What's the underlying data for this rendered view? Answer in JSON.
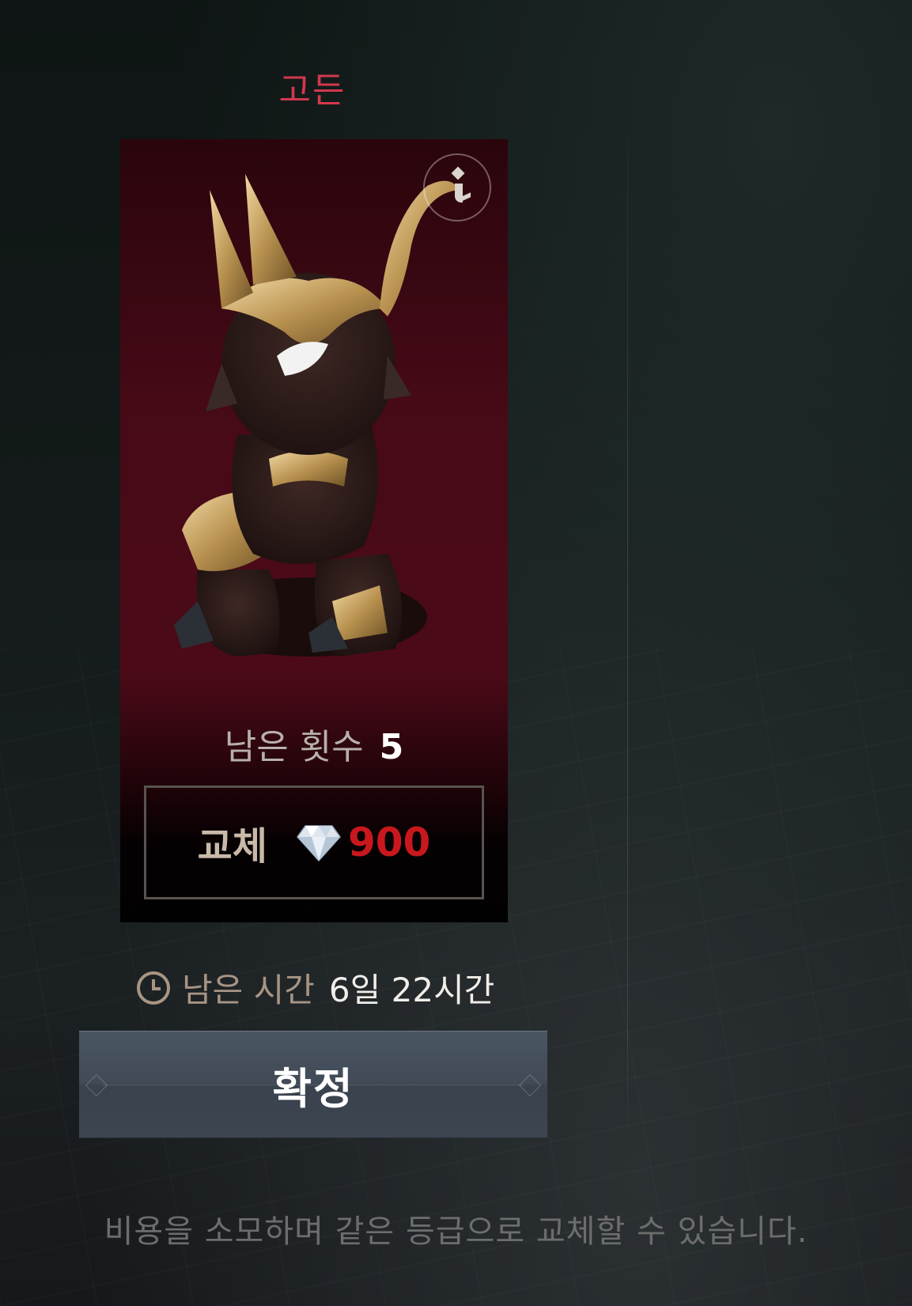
{
  "character": {
    "name": "고든"
  },
  "card": {
    "remaining_label": "남은 횟수",
    "remaining_count": "5",
    "swap_label": "교체",
    "swap_price": "900",
    "currency_icon": "diamond-icon"
  },
  "timer": {
    "label": "남은 시간",
    "value": "6일 22시간",
    "icon": "clock-icon"
  },
  "confirm": {
    "label": "확정"
  },
  "footnote": "비용을 소모하며 같은 등급으로 교체할 수 있습니다.",
  "colors": {
    "name": "#d2384e",
    "price": "#c8181e",
    "card_bg": "#470a17",
    "button": "#414b57"
  }
}
